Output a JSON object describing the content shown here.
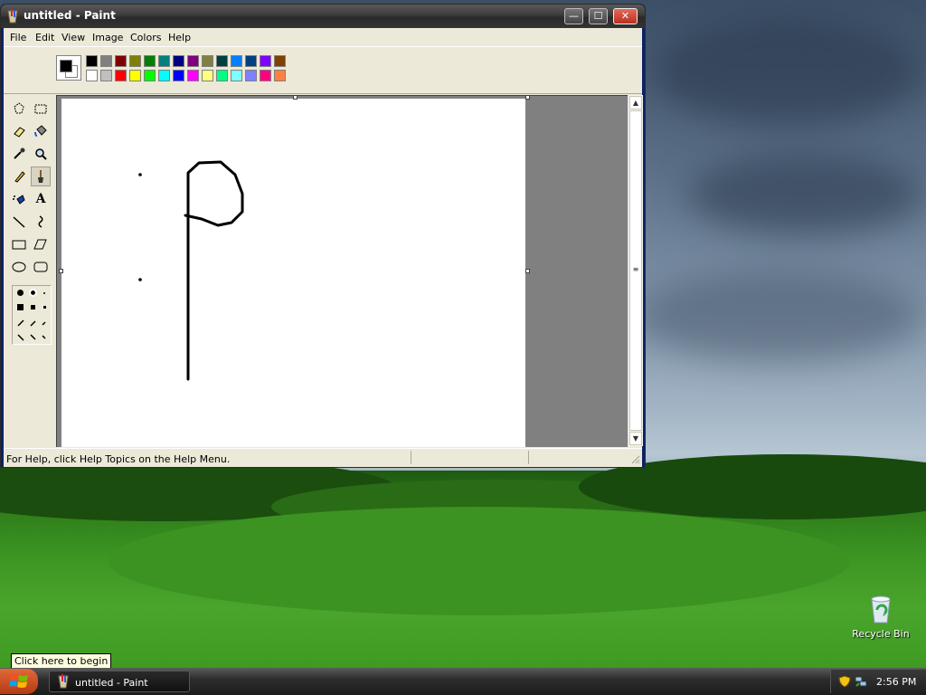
{
  "window": {
    "title": "untitled - Paint",
    "buttons": {
      "minimize": "—",
      "maximize": "☐",
      "close": "✕"
    }
  },
  "menu": [
    "File",
    "Edit",
    "View",
    "Image",
    "Colors",
    "Help"
  ],
  "palette": {
    "foreground": "#000000",
    "background": "#ffffff",
    "row1": [
      "#000000",
      "#808080",
      "#800000",
      "#808000",
      "#008000",
      "#008080",
      "#000080",
      "#800080",
      "#808040",
      "#004040",
      "#0080ff",
      "#004080",
      "#8000ff",
      "#804000"
    ],
    "row2": [
      "#ffffff",
      "#c0c0c0",
      "#ff0000",
      "#ffff00",
      "#00ff00",
      "#00ffff",
      "#0000ff",
      "#ff00ff",
      "#ffff80",
      "#00ff80",
      "#80ffff",
      "#8080ff",
      "#ff0080",
      "#ff8040"
    ]
  },
  "tools": [
    {
      "name": "free-form-select",
      "icon": "free-select-icon"
    },
    {
      "name": "select",
      "icon": "rect-select-icon"
    },
    {
      "name": "eraser",
      "icon": "eraser-icon"
    },
    {
      "name": "fill-with-color",
      "icon": "fill-bucket-icon"
    },
    {
      "name": "pick-color",
      "icon": "eyedropper-icon"
    },
    {
      "name": "magnifier",
      "icon": "magnifier-icon"
    },
    {
      "name": "pencil",
      "icon": "pencil-icon"
    },
    {
      "name": "brush",
      "icon": "brush-icon",
      "selected": true
    },
    {
      "name": "airbrush",
      "icon": "airbrush-icon"
    },
    {
      "name": "text",
      "icon": "text-icon",
      "glyph": "A"
    },
    {
      "name": "line",
      "icon": "line-icon"
    },
    {
      "name": "curve",
      "icon": "curve-icon"
    },
    {
      "name": "rectangle",
      "icon": "rectangle-icon"
    },
    {
      "name": "polygon",
      "icon": "polygon-icon"
    },
    {
      "name": "ellipse",
      "icon": "ellipse-icon"
    },
    {
      "name": "rounded-rectangle",
      "icon": "rounded-rect-icon"
    }
  ],
  "status": {
    "text": "For Help, click Help Topics on the Help Menu."
  },
  "desktop": {
    "recycle_bin_label": "Recycle Bin",
    "tooltip": "Click here to begin"
  },
  "taskbar": {
    "task_label": "untitled - Paint",
    "clock": "2:56 PM"
  }
}
